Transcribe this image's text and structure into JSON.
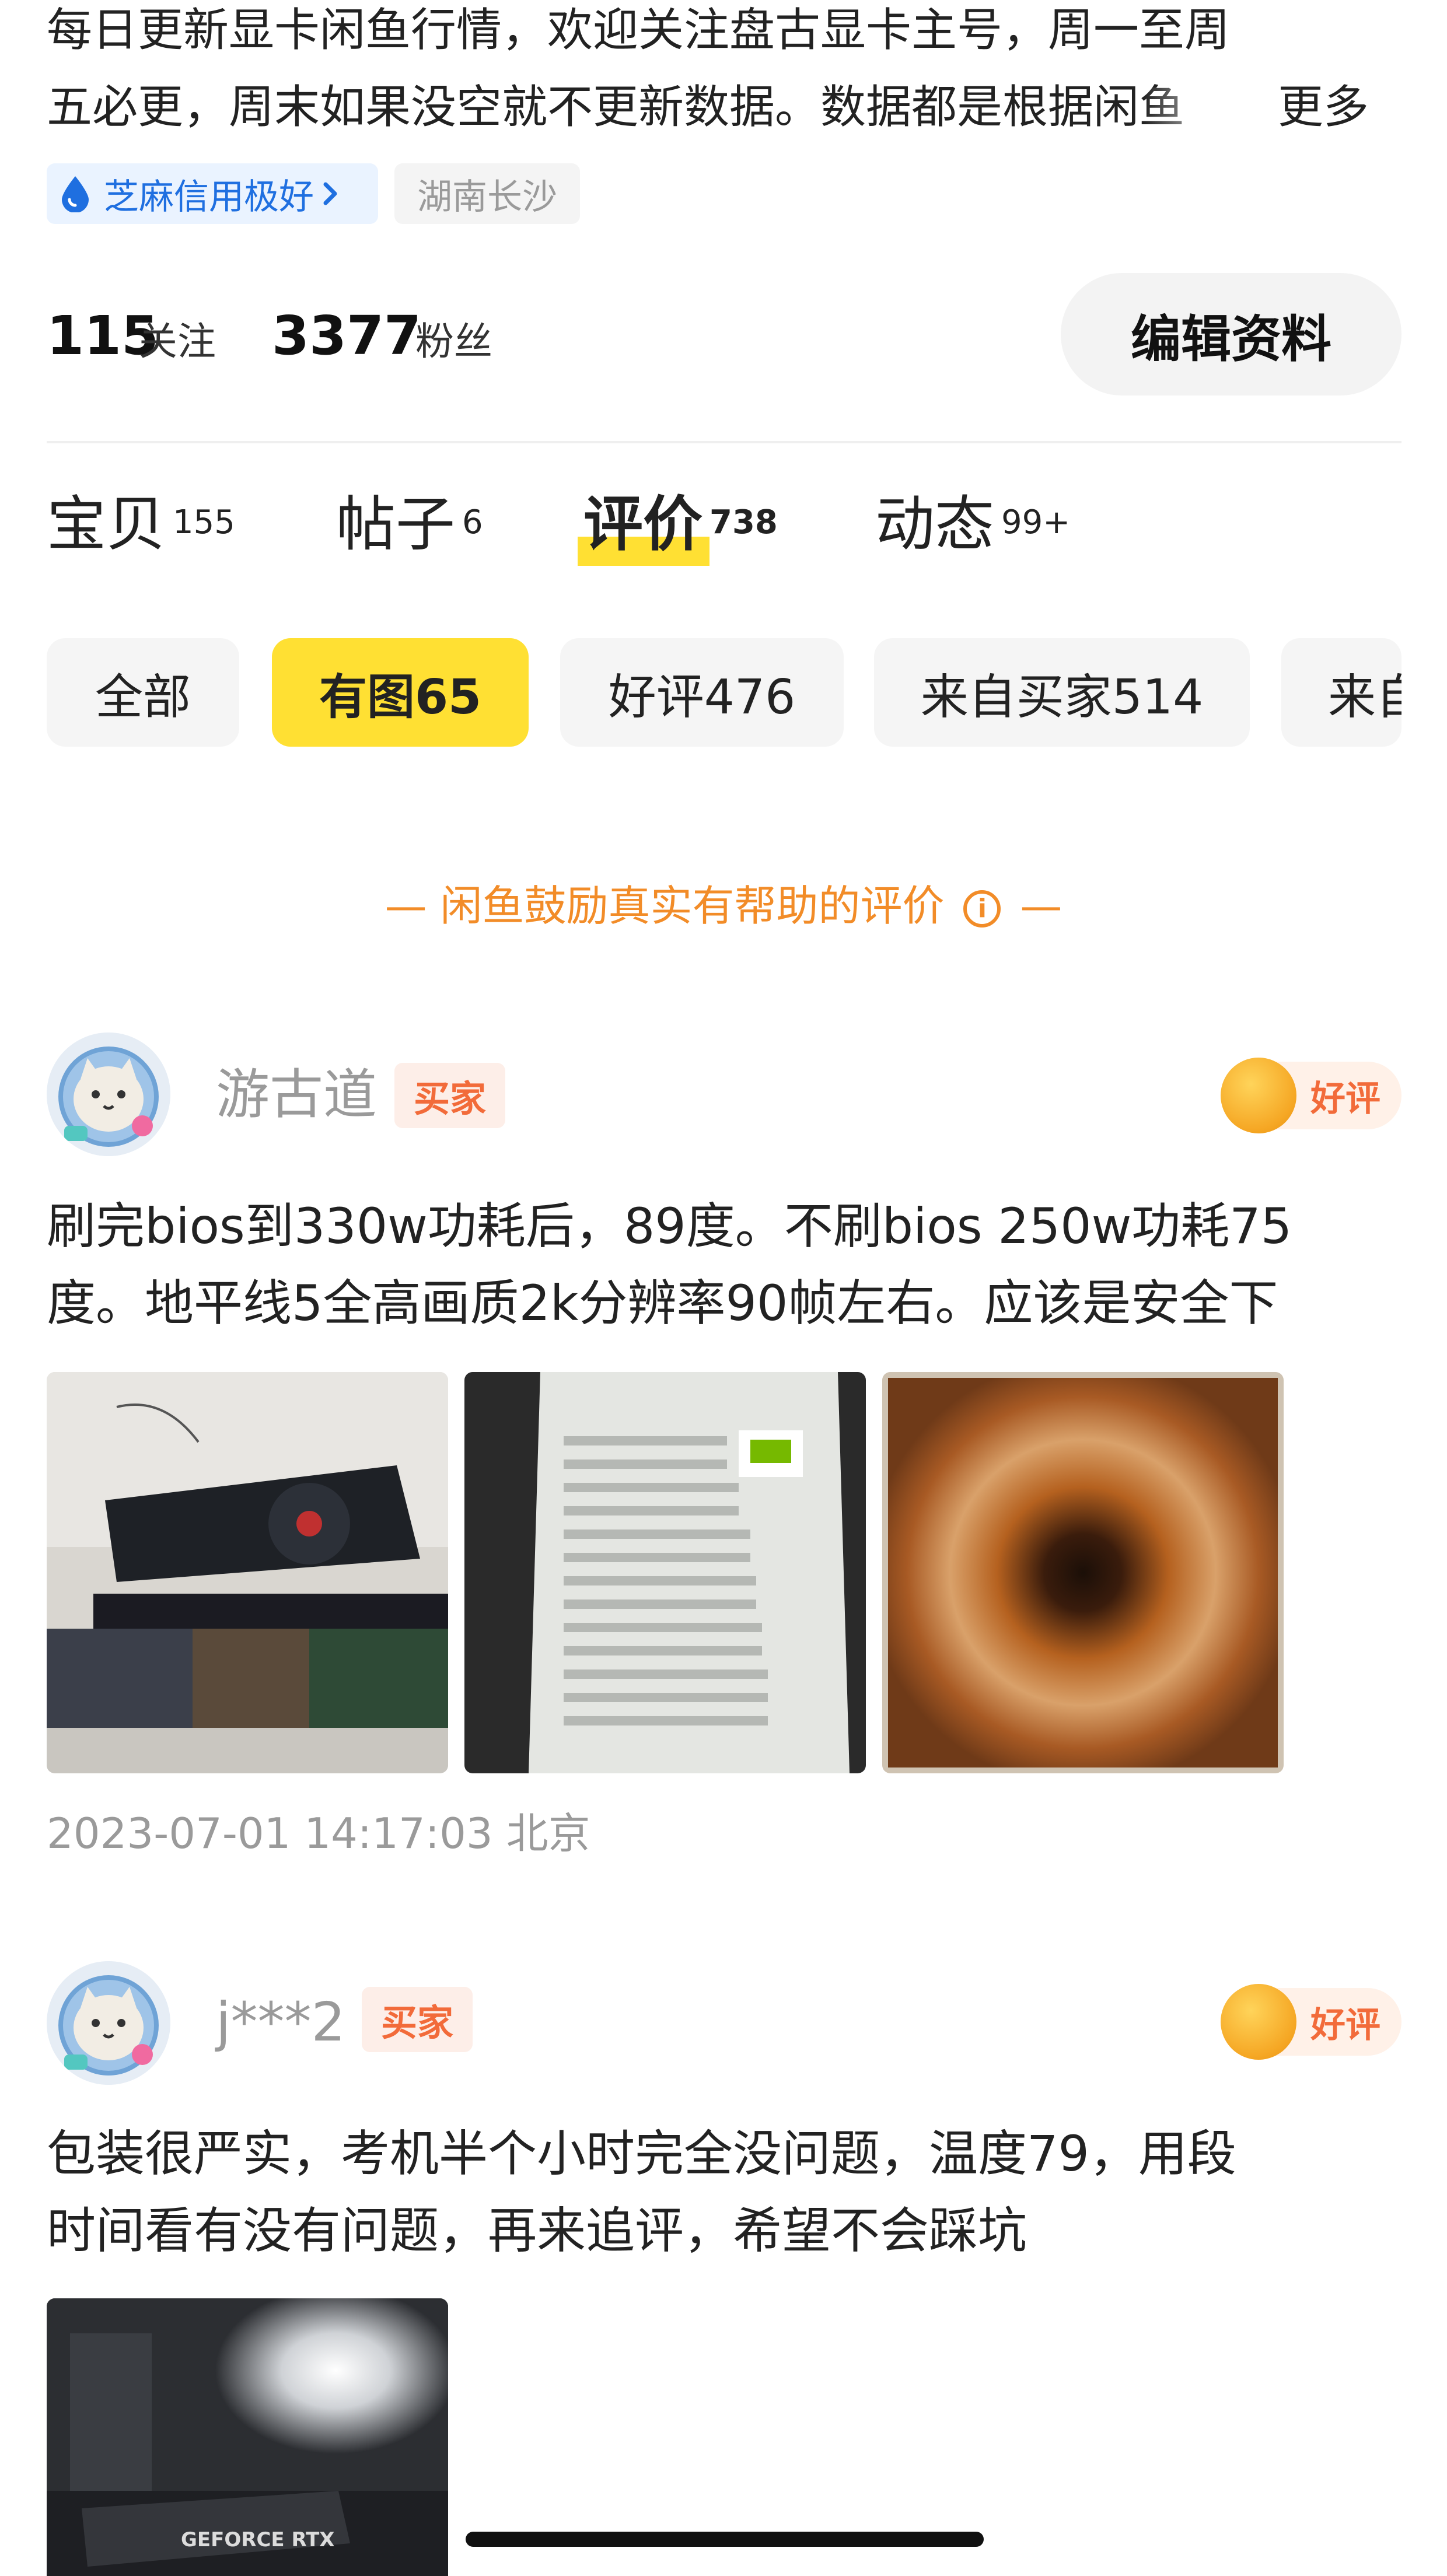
{
  "profile": {
    "bio_line1": "每日更新显卡闲鱼行情，欢迎关注盘古显卡主号，周一至周",
    "bio_line2": "五必更，周末如果没空就不更新数据。数据都是根据闲鱼",
    "bio_more": "更多",
    "credit_tag": "芝麻信用极好",
    "location_tag": "湖南长沙",
    "following_count": "115",
    "following_label": "关注",
    "followers_count": "3377",
    "followers_label": "粉丝",
    "edit_button": "编辑资料"
  },
  "tabs": [
    {
      "label": "宝贝",
      "count": "155"
    },
    {
      "label": "帖子",
      "count": "6"
    },
    {
      "label": "评价",
      "count": "738",
      "active": true
    },
    {
      "label": "动态",
      "count": "99+"
    }
  ],
  "filters": [
    {
      "label": "全部"
    },
    {
      "label": "有图65",
      "active": true
    },
    {
      "label": "好评476"
    },
    {
      "label": "来自买家514"
    },
    {
      "label": "来自"
    }
  ],
  "notice": {
    "text": "闲鱼鼓励真实有帮助的评价",
    "dash": "—",
    "info_glyph": "i"
  },
  "reviews": [
    {
      "user": "游古道",
      "role_tag": "买家",
      "rating": "好评",
      "text_line1": "刷完bios到330w功耗后，89度。不刷bios 250w功耗75",
      "text_line2": "度。地平线5全高画质2k分辨率90帧左右。应该是安全下",
      "photos": [
        "graphics-card-on-box",
        "gpu-z-screenshot",
        "thermal-paste-pattern"
      ],
      "time": "2023-07-01 14:17:03 北京"
    },
    {
      "user": "j***2",
      "role_tag": "买家",
      "rating": "好评",
      "text_line1": "包装很严实，考机半个小时完全没问题，温度79，用段",
      "text_line2": "时间看有没有问题，再来追评，希望不会踩坑",
      "photos": [
        "installed-geforce-rtx"
      ],
      "photo_text": "GEFORCE RTX"
    }
  ],
  "colors": {
    "accent_yellow": "#ffe033",
    "orange": "#f28c28",
    "buyer_tag": "#f26b3a",
    "credit_blue": "#1f6fe0"
  }
}
